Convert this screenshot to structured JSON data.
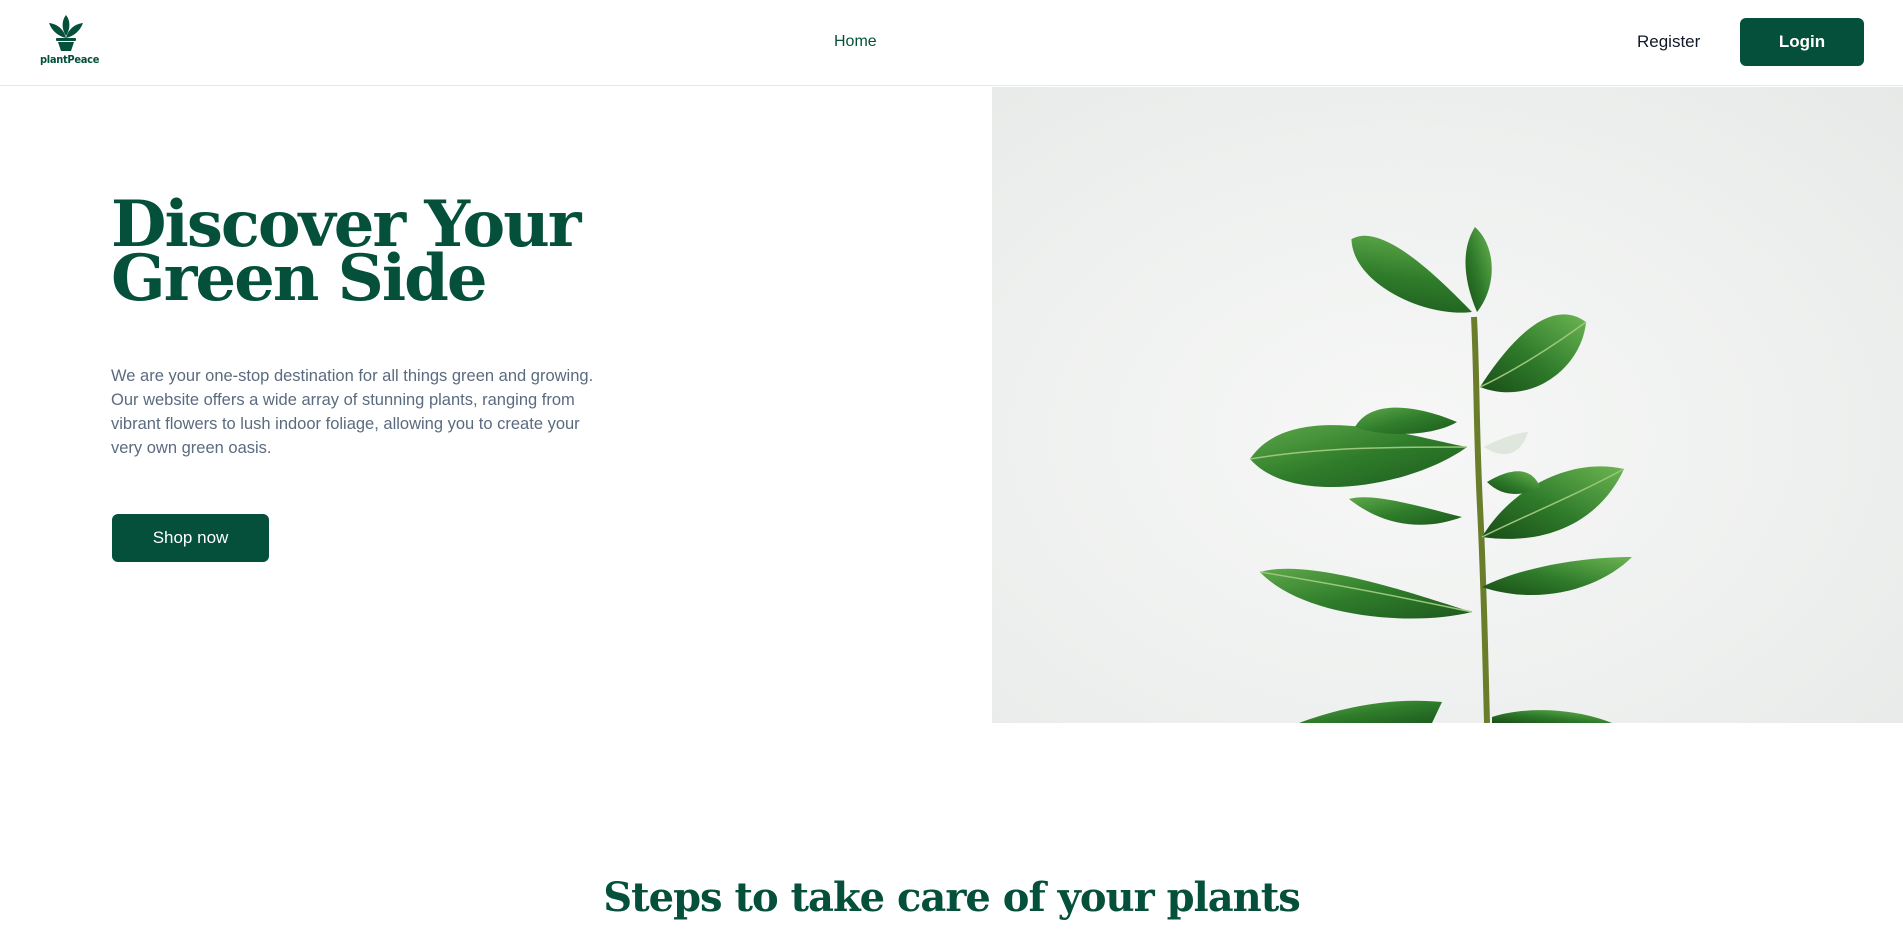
{
  "brand": {
    "name": "plantPeace",
    "logo_icon": "plant-pot-icon"
  },
  "nav": {
    "home": "Home",
    "register": "Register",
    "login": "Login"
  },
  "hero": {
    "title_line1": "Discover Your",
    "title_line2": "Green Side",
    "description": "We are your one-stop destination for all things green and growing. Our website offers a wide array of stunning plants, ranging from vibrant flowers to lush indoor foliage, allowing you to create your very own green oasis.",
    "cta": "Shop now",
    "image": "ficus-plant-photo"
  },
  "steps": {
    "title": "Steps to take care of your plants"
  },
  "colors": {
    "primary": "#05503a",
    "text_muted": "#5b6b7f",
    "nav_text": "#111827"
  }
}
